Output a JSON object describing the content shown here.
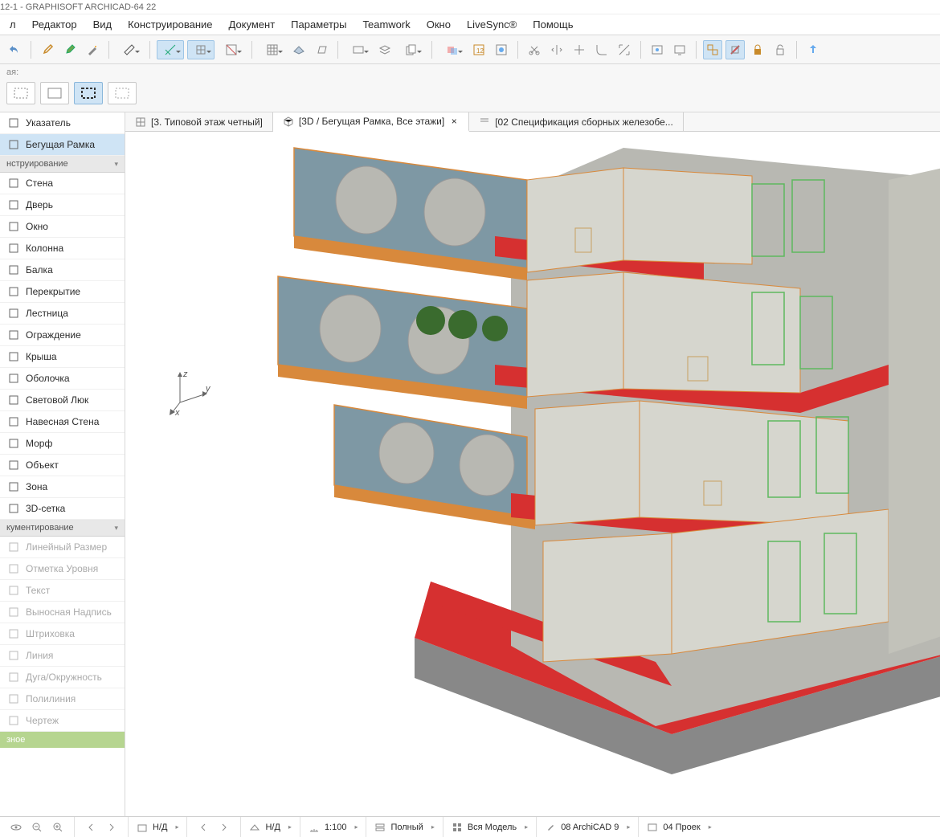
{
  "window": {
    "title": "12-1 - GRAPHISOFT ARCHICAD-64 22"
  },
  "menu": [
    "л",
    "Редактор",
    "Вид",
    "Конструирование",
    "Документ",
    "Параметры",
    "Teamwork",
    "Окно",
    "LiveSync®",
    "Помощь"
  ],
  "panel2_label": "ая:",
  "sidebar": {
    "groups": [
      {
        "label": "",
        "items": [
          {
            "label": "Указатель",
            "icon": "arrow"
          },
          {
            "label": "Бегущая Рамка",
            "icon": "marquee",
            "selected": true
          }
        ]
      },
      {
        "label": "нструирование",
        "items": [
          {
            "label": "Стена",
            "icon": "wall"
          },
          {
            "label": "Дверь",
            "icon": "door"
          },
          {
            "label": "Окно",
            "icon": "window"
          },
          {
            "label": "Колонна",
            "icon": "column"
          },
          {
            "label": "Балка",
            "icon": "beam"
          },
          {
            "label": "Перекрытие",
            "icon": "slab"
          },
          {
            "label": "Лестница",
            "icon": "stair"
          },
          {
            "label": "Ограждение",
            "icon": "railing"
          },
          {
            "label": "Крыша",
            "icon": "roof"
          },
          {
            "label": "Оболочка",
            "icon": "shell"
          },
          {
            "label": "Световой Люк",
            "icon": "skylight"
          },
          {
            "label": "Навесная Стена",
            "icon": "curtainwall"
          },
          {
            "label": "Морф",
            "icon": "morph"
          },
          {
            "label": "Объект",
            "icon": "object"
          },
          {
            "label": "Зона",
            "icon": "zone"
          },
          {
            "label": "3D-сетка",
            "icon": "mesh"
          }
        ]
      },
      {
        "label": "кументирование",
        "items": [
          {
            "label": "Линейный Размер",
            "icon": "dim",
            "dimmed": true
          },
          {
            "label": "Отметка Уровня",
            "icon": "level",
            "dimmed": true
          },
          {
            "label": "Текст",
            "icon": "text",
            "dimmed": true
          },
          {
            "label": "Выносная Надпись",
            "icon": "label",
            "dimmed": true
          },
          {
            "label": "Штриховка",
            "icon": "hatch",
            "dimmed": true
          },
          {
            "label": "Линия",
            "icon": "line",
            "dimmed": true
          },
          {
            "label": "Дуга/Окружность",
            "icon": "arc",
            "dimmed": true
          },
          {
            "label": "Полилиния",
            "icon": "poly",
            "dimmed": true
          },
          {
            "label": "Чертеж",
            "icon": "drawing",
            "dimmed": true
          }
        ]
      }
    ],
    "bottom": "зное"
  },
  "tabs": [
    {
      "label": "[3. Типовой этаж четный]",
      "icon": "plan"
    },
    {
      "label": "[3D / Бегущая Рамка, Все этажи]",
      "icon": "3d",
      "active": true,
      "closable": true
    },
    {
      "label": "[02 Спецификация сборных железобе...",
      "icon": "schedule"
    }
  ],
  "axis": {
    "x": "x",
    "y": "y",
    "z": "z"
  },
  "status": {
    "nd1": "Н/Д",
    "nd2": "Н/Д",
    "scale": "1:100",
    "filter": "Полный",
    "model": "Вся Модель",
    "pen": "08 ArchiCAD 9",
    "proj": "04 Проек"
  }
}
